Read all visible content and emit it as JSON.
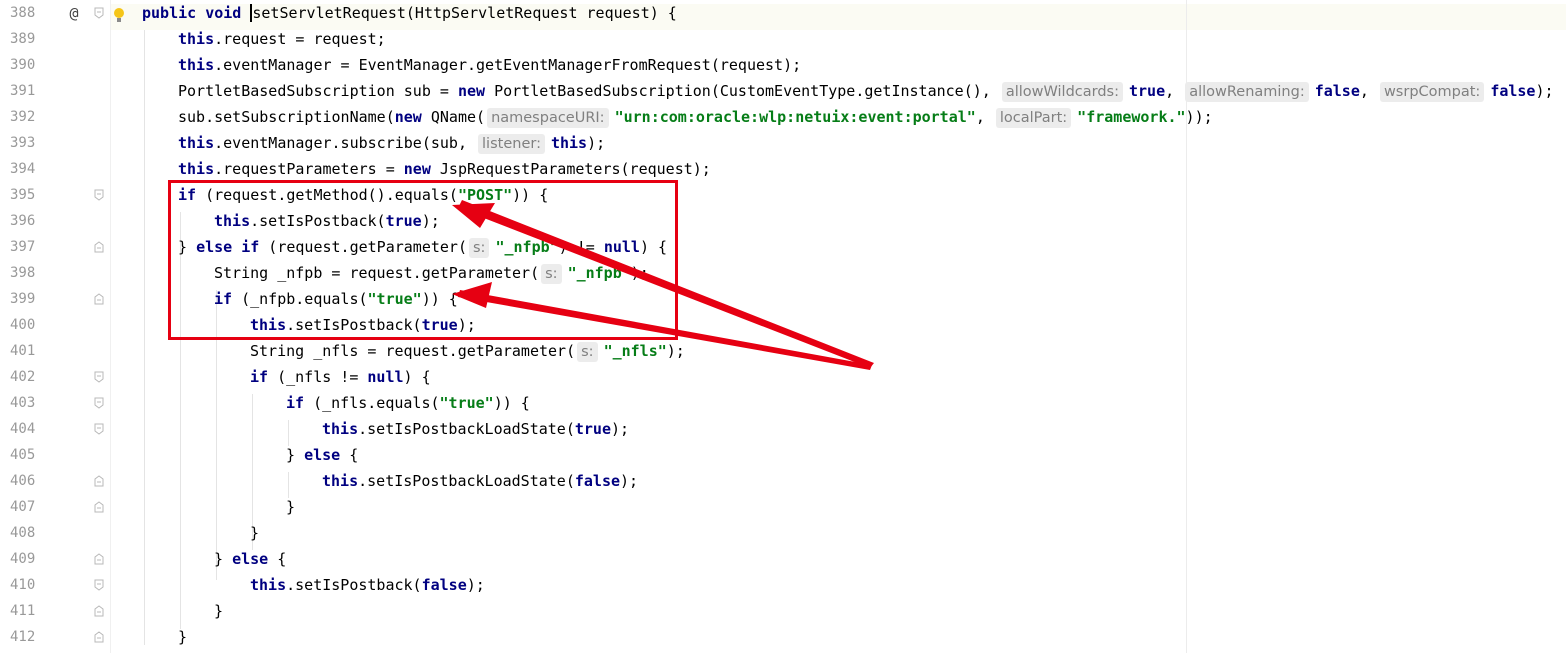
{
  "editor": {
    "lines": [
      {
        "num": "388",
        "mark": "@",
        "segments": [
          {
            "t": "public void ",
            "c": "kw"
          },
          {
            "t": "setServletRequest",
            "c": "caret"
          },
          {
            "t": "(HttpServletRequest request) {",
            "c": ""
          }
        ]
      },
      {
        "num": "389",
        "segments": [
          {
            "t": "this",
            "c": "kw"
          },
          {
            "t": ".request = request;",
            "c": ""
          }
        ]
      },
      {
        "num": "390",
        "segments": [
          {
            "t": "this",
            "c": "kw"
          },
          {
            "t": ".eventManager = EventManager.getEventManagerFromRequest(request);",
            "c": ""
          }
        ]
      },
      {
        "num": "391",
        "segments": [
          {
            "t": "PortletBasedSubscription sub = ",
            "c": ""
          },
          {
            "t": "new",
            "c": "kw"
          },
          {
            "t": " PortletBasedSubscription(CustomEventType.getInstance(), ",
            "c": ""
          },
          {
            "t": "allowWildcards:",
            "c": "hint"
          },
          {
            "t": "true",
            "c": "kw"
          },
          {
            "t": ", ",
            "c": ""
          },
          {
            "t": "allowRenaming:",
            "c": "hint"
          },
          {
            "t": "false",
            "c": "kw"
          },
          {
            "t": ", ",
            "c": ""
          },
          {
            "t": "wsrpCompat:",
            "c": "hint"
          },
          {
            "t": "false",
            "c": "kw"
          },
          {
            "t": ");",
            "c": ""
          }
        ]
      },
      {
        "num": "392",
        "segments": [
          {
            "t": "sub.setSubscriptionName(",
            "c": ""
          },
          {
            "t": "new",
            "c": "kw"
          },
          {
            "t": " QName(",
            "c": ""
          },
          {
            "t": "namespaceURI:",
            "c": "hint"
          },
          {
            "t": "\"urn:com:oracle:wlp:netuix:event:portal\"",
            "c": "str"
          },
          {
            "t": ", ",
            "c": ""
          },
          {
            "t": "localPart:",
            "c": "hint"
          },
          {
            "t": "\"framework.\"",
            "c": "str"
          },
          {
            "t": "));",
            "c": ""
          }
        ]
      },
      {
        "num": "393",
        "segments": [
          {
            "t": "this",
            "c": "kw"
          },
          {
            "t": ".eventManager.subscribe(sub, ",
            "c": ""
          },
          {
            "t": "listener:",
            "c": "hint"
          },
          {
            "t": "this",
            "c": "kw"
          },
          {
            "t": ");",
            "c": ""
          }
        ]
      },
      {
        "num": "394",
        "segments": [
          {
            "t": "this",
            "c": "kw"
          },
          {
            "t": ".requestParameters = ",
            "c": ""
          },
          {
            "t": "new",
            "c": "kw"
          },
          {
            "t": " JspRequestParameters(request);",
            "c": ""
          }
        ]
      },
      {
        "num": "395",
        "segments": [
          {
            "t": "if",
            "c": "kw"
          },
          {
            "t": " (request.getMethod().equals(",
            "c": ""
          },
          {
            "t": "\"POST\"",
            "c": "str"
          },
          {
            "t": ")) {",
            "c": ""
          }
        ]
      },
      {
        "num": "396",
        "segments": [
          {
            "t": "this",
            "c": "kw"
          },
          {
            "t": ".setIsPostback(",
            "c": ""
          },
          {
            "t": "true",
            "c": "kw"
          },
          {
            "t": ");",
            "c": ""
          }
        ]
      },
      {
        "num": "397",
        "segments": [
          {
            "t": "} ",
            "c": ""
          },
          {
            "t": "else if",
            "c": "kw"
          },
          {
            "t": " (request.getParameter(",
            "c": ""
          },
          {
            "t": "s:",
            "c": "hint"
          },
          {
            "t": "\"_nfpb\"",
            "c": "str"
          },
          {
            "t": ") != ",
            "c": ""
          },
          {
            "t": "null",
            "c": "kw"
          },
          {
            "t": ") {",
            "c": ""
          }
        ]
      },
      {
        "num": "398",
        "segments": [
          {
            "t": "String _nfpb = request.getParameter(",
            "c": ""
          },
          {
            "t": "s:",
            "c": "hint"
          },
          {
            "t": "\"_nfpb\"",
            "c": "str"
          },
          {
            "t": ");",
            "c": ""
          }
        ]
      },
      {
        "num": "399",
        "segments": [
          {
            "t": "if",
            "c": "kw"
          },
          {
            "t": " (_nfpb.equals(",
            "c": ""
          },
          {
            "t": "\"true\"",
            "c": "str"
          },
          {
            "t": ")) {",
            "c": ""
          }
        ]
      },
      {
        "num": "400",
        "segments": [
          {
            "t": "this",
            "c": "kw"
          },
          {
            "t": ".setIsPostback(",
            "c": ""
          },
          {
            "t": "true",
            "c": "kw"
          },
          {
            "t": ");",
            "c": ""
          }
        ]
      },
      {
        "num": "401",
        "segments": [
          {
            "t": "String _nfls = request.getParameter(",
            "c": ""
          },
          {
            "t": "s:",
            "c": "hint"
          },
          {
            "t": "\"_nfls\"",
            "c": "str"
          },
          {
            "t": ");",
            "c": ""
          }
        ]
      },
      {
        "num": "402",
        "segments": [
          {
            "t": "if",
            "c": "kw"
          },
          {
            "t": " (_nfls != ",
            "c": ""
          },
          {
            "t": "null",
            "c": "kw"
          },
          {
            "t": ") {",
            "c": ""
          }
        ]
      },
      {
        "num": "403",
        "segments": [
          {
            "t": "if",
            "c": "kw"
          },
          {
            "t": " (_nfls.equals(",
            "c": ""
          },
          {
            "t": "\"true\"",
            "c": "str"
          },
          {
            "t": ")) {",
            "c": ""
          }
        ]
      },
      {
        "num": "404",
        "segments": [
          {
            "t": "this",
            "c": "kw"
          },
          {
            "t": ".setIsPostbackLoadState(",
            "c": ""
          },
          {
            "t": "true",
            "c": "kw"
          },
          {
            "t": ");",
            "c": ""
          }
        ]
      },
      {
        "num": "405",
        "segments": [
          {
            "t": "} ",
            "c": ""
          },
          {
            "t": "else",
            "c": "kw"
          },
          {
            "t": " {",
            "c": ""
          }
        ]
      },
      {
        "num": "406",
        "segments": [
          {
            "t": "this",
            "c": "kw"
          },
          {
            "t": ".setIsPostbackLoadState(",
            "c": ""
          },
          {
            "t": "false",
            "c": "kw"
          },
          {
            "t": ");",
            "c": ""
          }
        ]
      },
      {
        "num": "407",
        "segments": [
          {
            "t": "}",
            "c": ""
          }
        ]
      },
      {
        "num": "408",
        "segments": [
          {
            "t": "}",
            "c": ""
          }
        ]
      },
      {
        "num": "409",
        "segments": [
          {
            "t": "} ",
            "c": ""
          },
          {
            "t": "else",
            "c": "kw"
          },
          {
            "t": " {",
            "c": ""
          }
        ]
      },
      {
        "num": "410",
        "segments": [
          {
            "t": "this",
            "c": "kw"
          },
          {
            "t": ".setIsPostback(",
            "c": ""
          },
          {
            "t": "false",
            "c": "kw"
          },
          {
            "t": ");",
            "c": ""
          }
        ]
      },
      {
        "num": "411",
        "segments": [
          {
            "t": "}",
            "c": ""
          }
        ]
      },
      {
        "num": "412",
        "segments": [
          {
            "t": "}",
            "c": ""
          }
        ]
      }
    ]
  },
  "colors": {
    "keyword": "#000080",
    "string": "#067d17",
    "hint_bg": "#ececec",
    "line_number": "#999999",
    "annotation": "#e60012"
  },
  "icons": {
    "override_marker": "at-sign-icon",
    "intention_bulb": "lightbulb-icon",
    "fold": "fold-marker-icon"
  }
}
